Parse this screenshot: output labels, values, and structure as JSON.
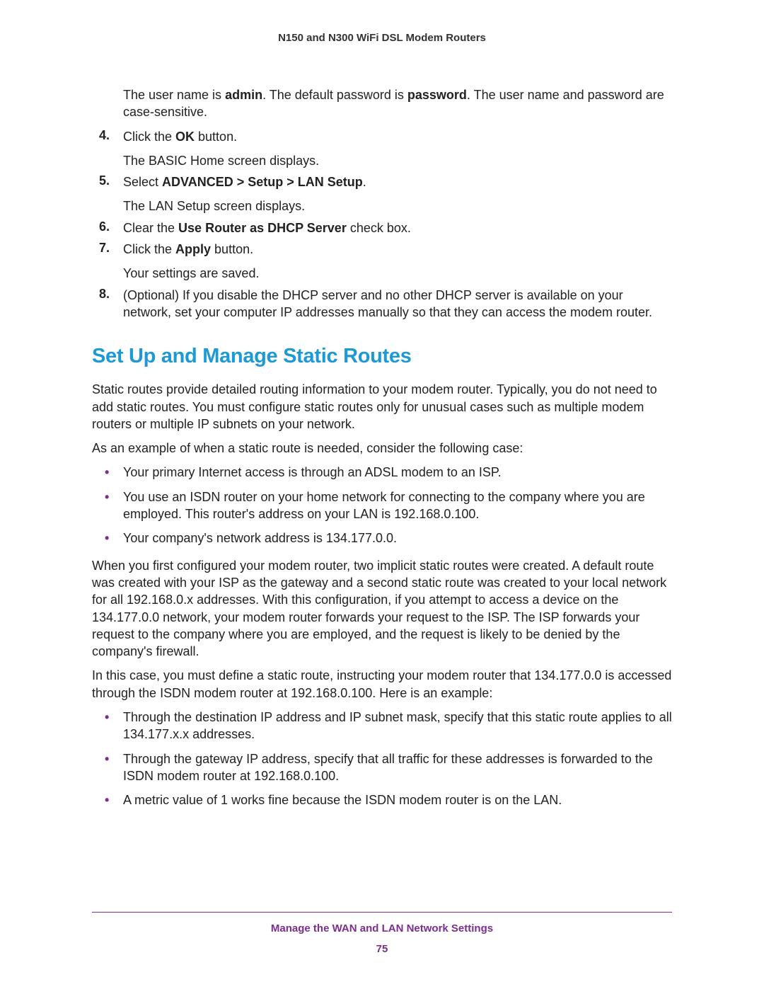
{
  "header": {
    "title": "N150 and N300 WiFi DSL Modem Routers"
  },
  "intro": {
    "p1a": "The user name is ",
    "p1b": "admin",
    "p1c": ". The default password is ",
    "p1d": "password",
    "p1e": ". The user name and password are case-sensitive."
  },
  "steps": {
    "s4a": "Click the ",
    "s4b": "OK",
    "s4c": " button.",
    "s4sub": "The BASIC Home screen displays.",
    "s5a": "Select ",
    "s5b": "ADVANCED > Setup > LAN Setup",
    "s5c": ".",
    "s5sub": "The LAN Setup screen displays.",
    "s6a": "Clear the ",
    "s6b": "Use Router as DHCP Server",
    "s6c": " check box.",
    "s7a": "Click the ",
    "s7b": "Apply",
    "s7c": " button.",
    "s7sub": "Your settings are saved.",
    "s8": "(Optional) If you disable the DHCP server and no other DHCP server is available on your network, set your computer IP addresses manually so that they can access the modem router."
  },
  "section": {
    "title": "Set Up and Manage Static Routes"
  },
  "paras": {
    "p1": "Static routes provide detailed routing information to your modem router. Typically, you do not need to add static routes. You must configure static routes only for unusual cases such as multiple modem routers or multiple IP subnets on your network.",
    "p2": "As an example of when a static route is needed, consider the following case:",
    "b1": "Your primary Internet access is through an ADSL modem to an ISP.",
    "b2": "You use an ISDN router on your home network for connecting to the company where you are employed. This router's address on your LAN is 192.168.0.100.",
    "b3": "Your company's network address is 134.177.0.0.",
    "p3": "When you first configured your modem router, two implicit static routes were created. A default route was created with your ISP as the gateway and a second static route was created to your local network for all 192.168.0.x addresses. With this configuration, if you attempt to access a device on the 134.177.0.0 network, your modem router forwards your request to the ISP. The ISP forwards your request to the company where you are employed, and the request is likely to be denied by the company's firewall.",
    "p4": "In this case, you must define a static route, instructing your modem router that 134.177.0.0 is accessed through the ISDN modem router at 192.168.0.100. Here is an example:",
    "c1": "Through the destination IP address and IP subnet mask, specify that this static route applies to all 134.177.x.x addresses.",
    "c2": "Through the gateway IP address, specify that all traffic for these addresses is forwarded to the ISDN modem router at 192.168.0.100.",
    "c3": "A metric value of 1 works fine because the ISDN modem router is on the LAN."
  },
  "footer": {
    "section": "Manage the WAN and LAN Network Settings",
    "page": "75"
  }
}
